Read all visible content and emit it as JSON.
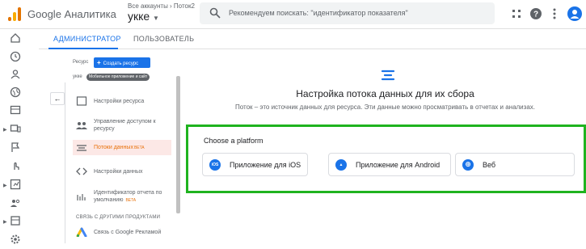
{
  "header": {
    "product_name": "Google Аналитика",
    "account_crumb": "Все аккаунты › Поток2",
    "account_name": "укке",
    "search_placeholder": "Рекомендуем поискать: \"идентификатор показателя\""
  },
  "tabs": [
    {
      "label": "АДМИНИСТРАТОР",
      "active": true
    },
    {
      "label": "ПОЛЬЗОВАТЕЛЬ",
      "active": false
    }
  ],
  "admin": {
    "resource_label": "Ресурс",
    "create_resource_label": "Создать ресурс",
    "property_name": "укке",
    "property_chip": "Мобильное приложение и сайт",
    "back_label": "←",
    "menu": [
      {
        "label": "Настройки ресурса",
        "icon": "property-settings-icon",
        "selected": false
      },
      {
        "label": "Управление доступом к ресурсу",
        "icon": "people-icon",
        "selected": false
      },
      {
        "label": "Потоки данных",
        "badge": "BETA",
        "icon": "data-streams-icon",
        "selected": true
      },
      {
        "label": "Настройки данных",
        "icon": "code-icon",
        "selected": false
      },
      {
        "label": "Идентификатор отчета по умолчанию",
        "badge": "BETA",
        "icon": "reporting-identity-icon",
        "selected": false
      }
    ],
    "linking_section_title": "СВЯЗЬ С ДРУГИМИ ПРОДУКТАМИ",
    "linking_items": [
      {
        "label": "Связь с Google Рекламой",
        "icon": "google-ads-icon"
      }
    ]
  },
  "main": {
    "title": "Настройка потока данных для их сбора",
    "description": "Поток – это источник данных для ресурса. Эти данные можно просматривать в отчетах и анализах.",
    "choose_platform": "Choose a platform",
    "platforms": [
      {
        "label": "Приложение для iOS",
        "icon": "ios-icon",
        "glyph": "iOS"
      },
      {
        "label": "Приложение для Android",
        "icon": "android-icon",
        "glyph": "▲"
      },
      {
        "label": "Веб",
        "icon": "web-icon",
        "glyph": "⊕"
      }
    ]
  },
  "colors": {
    "accent": "#1a73e8",
    "highlight_border": "#1fb31f",
    "selected_text": "#e8710a"
  }
}
